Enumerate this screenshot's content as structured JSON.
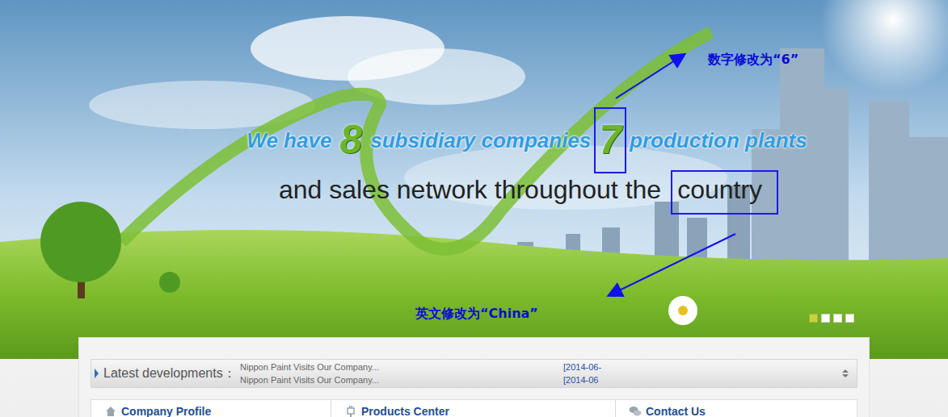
{
  "banner": {
    "headline": [
      {
        "text": "We have",
        "kind": "word",
        "annotated": false
      },
      {
        "text": "8",
        "kind": "number",
        "annotated": false
      },
      {
        "text": "subsidiary companies",
        "kind": "word",
        "annotated": false
      },
      {
        "text": "7",
        "kind": "number",
        "annotated": true
      },
      {
        "text": "production plants",
        "kind": "word",
        "annotated": false
      }
    ],
    "subline": [
      {
        "text": "and sales network throughout the",
        "annotated": false
      },
      {
        "text": "country",
        "annotated": true
      }
    ]
  },
  "annotations": [
    {
      "note": "数字修改为“6”"
    },
    {
      "note": "英文修改为“China”"
    }
  ],
  "carousel": [
    {
      "selected": true
    },
    {
      "selected": false
    },
    {
      "selected": false
    },
    {
      "selected": false
    }
  ],
  "news": {
    "label": "Latest developments：",
    "items": [
      {
        "title": "Nippon Paint Visits Our Company...",
        "date": "[2014-06-"
      },
      {
        "title": "Nippon Paint Visits Our Company...",
        "date": "[2014-06"
      }
    ]
  },
  "sections": [
    {
      "title": "Company Profile",
      "icon": "house"
    },
    {
      "title": "Products Center",
      "icon": "plug"
    },
    {
      "title": "Contact Us",
      "icon": "chat"
    }
  ]
}
